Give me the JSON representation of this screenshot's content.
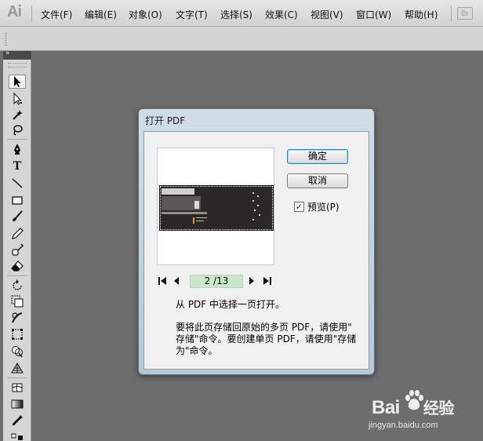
{
  "app": {
    "logo": "Ai",
    "bridge_button": "Br"
  },
  "menu": [
    {
      "label": "文件(F)"
    },
    {
      "label": "编辑(E)"
    },
    {
      "label": "对象(O)"
    },
    {
      "label": "文字(T)"
    },
    {
      "label": "选择(S)"
    },
    {
      "label": "效果(C)"
    },
    {
      "label": "视图(V)"
    },
    {
      "label": "窗口(W)"
    },
    {
      "label": "帮助(H)"
    }
  ],
  "tools_panel": {
    "collapse_glyph": "»",
    "tools": [
      {
        "name": "selection-tool-icon",
        "selected": true
      },
      {
        "name": "direct-selection-tool-icon"
      },
      {
        "name": "magic-wand-tool-icon"
      },
      {
        "name": "lasso-tool-icon"
      },
      {
        "name": "pen-tool-icon"
      },
      {
        "name": "type-tool-icon",
        "glyph": "T"
      },
      {
        "name": "line-segment-tool-icon"
      },
      {
        "name": "rectangle-tool-icon"
      },
      {
        "name": "paintbrush-tool-icon"
      },
      {
        "name": "pencil-tool-icon"
      },
      {
        "name": "blob-brush-tool-icon"
      },
      {
        "name": "eraser-tool-icon"
      },
      {
        "name": "rotate-tool-icon"
      },
      {
        "name": "scale-tool-icon"
      },
      {
        "name": "warp-tool-icon"
      },
      {
        "name": "free-transform-tool-icon"
      },
      {
        "name": "shape-builder-tool-icon"
      },
      {
        "name": "perspective-grid-tool-icon"
      },
      {
        "name": "mesh-tool-icon"
      },
      {
        "name": "gradient-tool-icon"
      },
      {
        "name": "eyedropper-tool-icon"
      },
      {
        "name": "blend-tool-icon"
      }
    ]
  },
  "dialog": {
    "title": "打开 PDF",
    "ok_label": "确定",
    "cancel_label": "取消",
    "preview_label": "预览(P)",
    "preview_checked": true,
    "page_indicator": "2 /13",
    "message_1": "从 PDF 中选择一页打开。",
    "message_2_line1": "要将此页存储回原始的多页 PDF，请使用\"",
    "message_2_line2": "存储\"命令。要创建单页 PDF，请使用\"存储",
    "message_2_line3": "为\"命令。"
  },
  "watermark": {
    "brand": "Bai",
    "brand_suffix": "经验",
    "url": "jingyan.baidu.com"
  },
  "colors": {
    "workspace": "#6d6d6d",
    "page_field": "#c9e8c9",
    "dialog_frame": "#b6c8d6"
  }
}
